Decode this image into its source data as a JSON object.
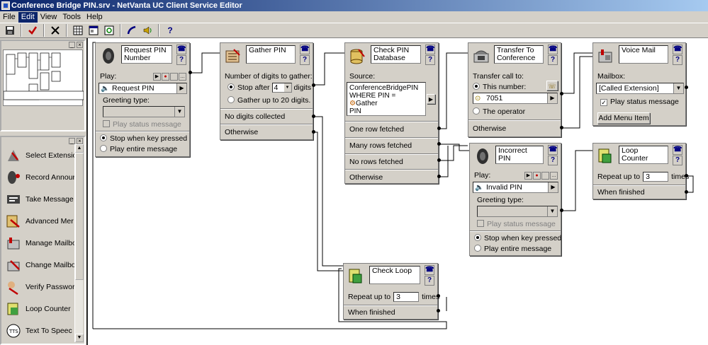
{
  "window": {
    "title": "Conference Bridge PIN.srv - NetVanta UC Client Service Editor"
  },
  "menu": [
    "File",
    "Edit",
    "View",
    "Tools",
    "Help"
  ],
  "toolbar": {
    "icons": [
      "save-icon",
      "check-icon",
      "close-icon",
      "grid-icon",
      "window-icon",
      "refresh-icon",
      "phone-icon",
      "speaker-icon",
      "help-icon"
    ]
  },
  "palette": {
    "items": [
      {
        "label": "Select Extensio",
        "icon": "extension-icon"
      },
      {
        "label": "Record Annour",
        "icon": "record-icon"
      },
      {
        "label": "Take Message",
        "icon": "message-icon"
      },
      {
        "label": "Advanced Mer",
        "icon": "menu-icon"
      },
      {
        "label": "Manage Mailbo",
        "icon": "mailbox-icon"
      },
      {
        "label": "Change Mailbo",
        "icon": "change-mailbox-icon"
      },
      {
        "label": "Verify Passwor",
        "icon": "password-icon"
      },
      {
        "label": "Loop Counter",
        "icon": "loop-icon"
      },
      {
        "label": "Text To Speec",
        "icon": "tts-icon"
      }
    ]
  },
  "nodes": {
    "request_pin": {
      "title": "Request PIN Number",
      "play_label": "Play:",
      "play_value": "Request PIN",
      "greeting_label": "Greeting type:",
      "status_label": "Play status message",
      "opt_stop": "Stop when key pressed",
      "opt_entire": "Play entire message"
    },
    "gather_pin": {
      "title": "Gather PIN",
      "digits_label": "Number of digits to gather:",
      "stop_after": "Stop after",
      "stop_value": "4",
      "digits": "digits",
      "gather_up": "Gather up to 20 digits.",
      "no_digits": "No digits collected",
      "otherwise": "Otherwise"
    },
    "check_pin": {
      "title": "Check PIN Database",
      "source_label": "Source:",
      "source_line1": "ConferenceBridgePIN",
      "source_line2": "WHERE PIN = ",
      "source_var": "Gather",
      "source_line3": "PIN",
      "one_row": "One row fetched",
      "many_rows": "Many rows fetched",
      "no_rows": "No rows fetched",
      "otherwise": "Otherwise"
    },
    "transfer": {
      "title": "Transfer To Conference",
      "transfer_label": "Transfer call to:",
      "this_number": "This number:",
      "number_value": "7051",
      "operator": "The operator",
      "otherwise": "Otherwise"
    },
    "voice_mail": {
      "title": "Voice Mail",
      "mailbox_label": "Mailbox:",
      "mailbox_value": "[Called Extension]",
      "status_label": "Play status message",
      "add_menu": "Add Menu Item"
    },
    "incorrect_pin": {
      "title": "Incorrect PIN",
      "play_label": "Play:",
      "play_value": "Invalid PIN",
      "greeting_label": "Greeting type:",
      "status_label": "Play status message",
      "opt_stop": "Stop when key pressed",
      "opt_entire": "Play entire message"
    },
    "loop_counter": {
      "title": "Loop Counter",
      "repeat_label": "Repeat up to",
      "repeat_value": "3",
      "times": "times",
      "finished": "When finished"
    },
    "check_loop": {
      "title": "Check Loop",
      "repeat_label": "Repeat up to",
      "repeat_value": "3",
      "times": "times",
      "finished": "When finished"
    }
  }
}
